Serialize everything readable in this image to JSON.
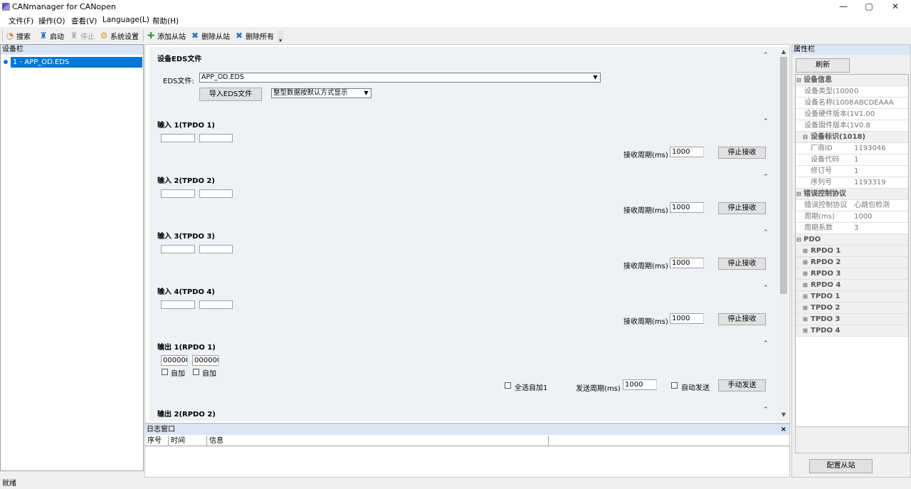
{
  "window": {
    "title": "CANmanager for CANopen",
    "minimize": "—",
    "maximize": "▢",
    "close": "✕"
  },
  "menu": [
    "文件(F)",
    "操作(O)",
    "查看(V)",
    "Language(L)",
    "帮助(H)"
  ],
  "toolbar": {
    "search": "搜索",
    "start": "启动",
    "stop": "停止",
    "system_settings": "系统设置",
    "add_slave": "添加从站",
    "remove_slave": "删除从站",
    "remove_all": "删除所有"
  },
  "device_panel": {
    "header": "设备栏",
    "items": [
      "1 - APP_OD.EDS"
    ]
  },
  "main": {
    "eds_section": {
      "title": "设备EDS文件",
      "file_label": "EDS文件:",
      "file_value": "APP_OD.EDS",
      "import_button": "导入EDS文件",
      "display_mode": "整型数据按默认方式显示"
    },
    "inputs": [
      {
        "title": "输入 1(TPDO 1)",
        "period_label": "接收周期(ms)",
        "period": "1000",
        "stop_button": "停止接收"
      },
      {
        "title": "输入 2(TPDO 2)",
        "period_label": "接收周期(ms)",
        "period": "1000",
        "stop_button": "停止接收"
      },
      {
        "title": "输入 3(TPDO 3)",
        "period_label": "接收周期(ms)",
        "period": "1000",
        "stop_button": "停止接收"
      },
      {
        "title": "输入 4(TPDO 4)",
        "period_label": "接收周期(ms)",
        "period": "1000",
        "stop_button": "停止接收"
      }
    ],
    "output1": {
      "title": "输出 1(RPDO 1)",
      "value1": "000000",
      "value2": "000000",
      "auto1": "自加",
      "auto2": "自加",
      "select_all": "全选自加1",
      "send_period_label": "发送周期(ms)",
      "send_period": "1000",
      "auto_send": "自动发送",
      "manual_send": "手动发送"
    },
    "output2": {
      "title": "输出 2(RPDO 2)"
    },
    "collapse_glyph": "⌃"
  },
  "log": {
    "header": "日志窗口",
    "close": "×",
    "columns": [
      "序号",
      "时间",
      "信息"
    ]
  },
  "props": {
    "header": "属性栏",
    "refresh": "刷新",
    "config_slave": "配置从站",
    "groups": {
      "device_info": "设备信息",
      "device_id": "设备标识(1018)",
      "error_ctrl": "错误控制协议",
      "pdo": "PDO"
    },
    "device_info": [
      {
        "name": "设备类型(1000",
        "value": "0"
      },
      {
        "name": "设备名称(1008",
        "value": "ABCDEAAA"
      },
      {
        "name": "设备硬件版本(1",
        "value": "V1.00"
      },
      {
        "name": "设备固件版本(1",
        "value": "V0.8"
      }
    ],
    "device_id": [
      {
        "name": "厂商ID",
        "value": "1193046"
      },
      {
        "name": "设备代码",
        "value": "1"
      },
      {
        "name": "修订号",
        "value": "1"
      },
      {
        "name": "序列号",
        "value": "1193319"
      }
    ],
    "error_ctrl": [
      {
        "name": "错误控制协议",
        "value": "心跳包检测"
      },
      {
        "name": "周期(ms)",
        "value": "1000"
      },
      {
        "name": "周期系数",
        "value": "3"
      }
    ],
    "pdos": [
      "RPDO 1",
      "RPDO 2",
      "RPDO 3",
      "RPDO 4",
      "TPDO 1",
      "TPDO 2",
      "TPDO 3",
      "TPDO 4"
    ]
  },
  "status": "就绪"
}
